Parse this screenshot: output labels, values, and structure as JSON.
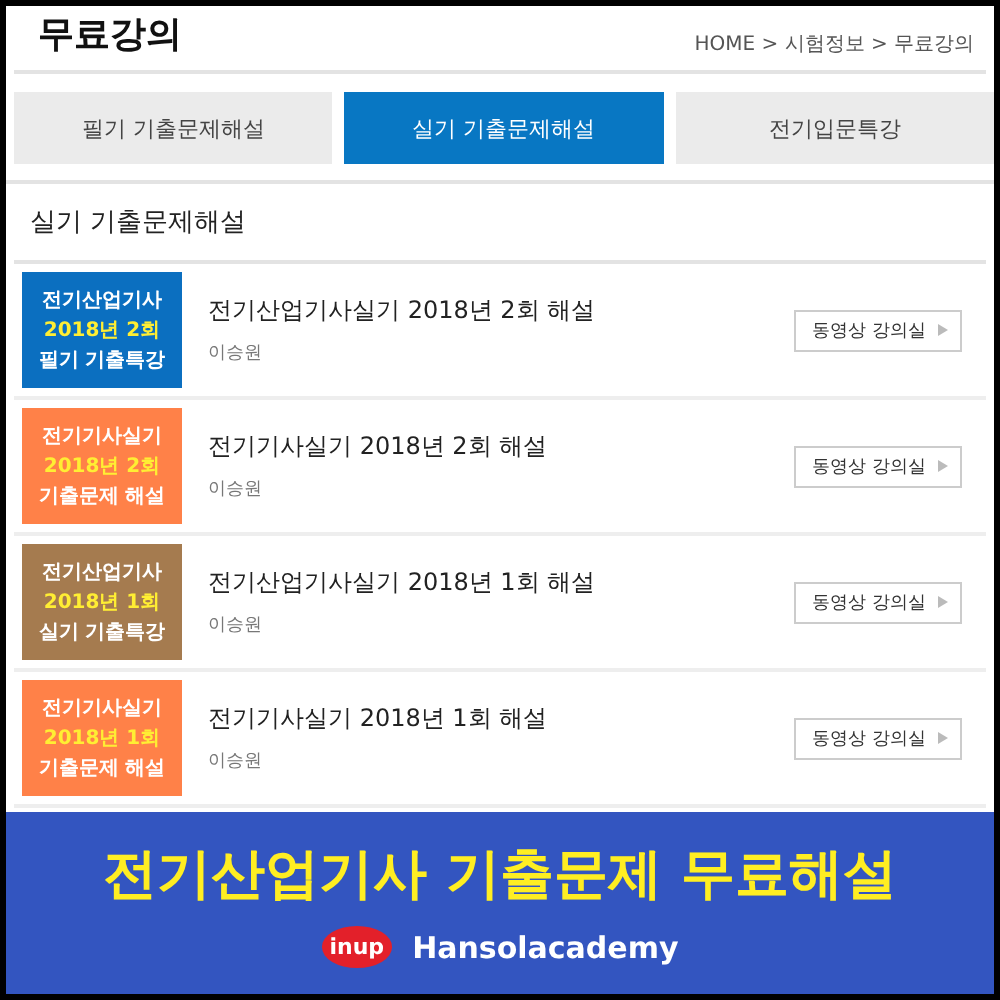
{
  "page": {
    "title": "무료강의",
    "breadcrumb": "HOME > 시험정보 > 무료강의"
  },
  "tabs": [
    {
      "label": "필기 기출문제해설",
      "selected": false
    },
    {
      "label": "실기 기출문제해설",
      "selected": true
    },
    {
      "label": "전기입문특강",
      "selected": false
    }
  ],
  "section_title": "실기 기출문제해설",
  "lectures": [
    {
      "thumb_lines": [
        "전기산업기사",
        "2018년 2회",
        "필기 기출특강"
      ],
      "color": "#0b6fc0",
      "title": "전기산업기사실기 2018년 2회 해설",
      "instructor": "이승원",
      "button": "동영상 강의실"
    },
    {
      "thumb_lines": [
        "전기기사실기",
        "2018년 2회",
        "기출문제 해설"
      ],
      "color": "#ff8148",
      "title": "전기기사실기 2018년 2회 해설",
      "instructor": "이승원",
      "button": "동영상 강의실"
    },
    {
      "thumb_lines": [
        "전기산업기사",
        "2018년 1회",
        "실기 기출특강"
      ],
      "color": "#a57b4f",
      "title": "전기산업기사실기 2018년 1회 해설",
      "instructor": "이승원",
      "button": "동영상 강의실"
    },
    {
      "thumb_lines": [
        "전기기사실기",
        "2018년 1회",
        "기출문제 해설"
      ],
      "color": "#ff8148",
      "title": "전기기사실기 2018년 1회 해설",
      "instructor": "이승원",
      "button": "동영상 강의실"
    }
  ],
  "banner": {
    "headline": "전기산업기사 기출문제 무료해설",
    "logo_text": "inup",
    "brand": "Hansolacademy"
  }
}
